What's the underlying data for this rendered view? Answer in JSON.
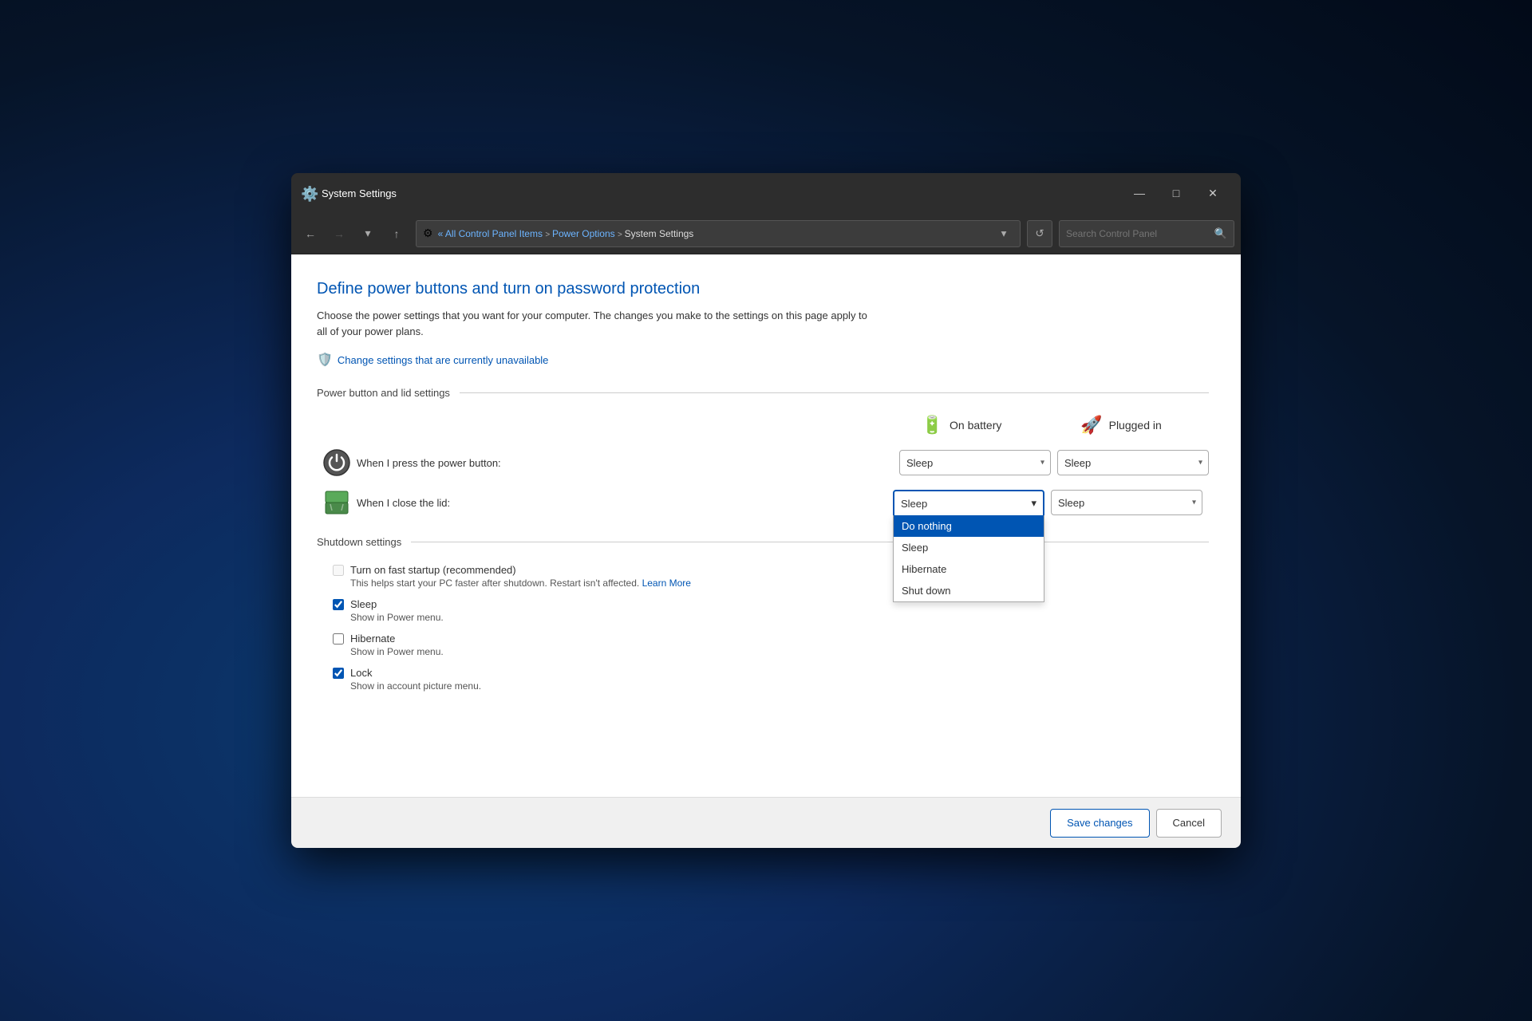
{
  "window": {
    "title": "System Settings",
    "icon": "⚙️"
  },
  "titlebar": {
    "minimize": "—",
    "maximize": "□",
    "close": "✕"
  },
  "navbar": {
    "back": "←",
    "forward": "→",
    "recent": "▾",
    "up": "↑",
    "address": {
      "icon": "⚙",
      "path": "« All Control Panel Items  >  Power Options  >  System Settings"
    },
    "search_placeholder": "Search Control Panel",
    "refresh": "↺"
  },
  "page": {
    "title": "Define power buttons and turn on password protection",
    "description": "Choose the power settings that you want for your computer. The changes you make to the settings on this page apply to all of your power plans.",
    "change_settings_link": "Change settings that are currently unavailable",
    "section_label": "Power button and lid settings",
    "columns": {
      "on_battery": "On battery",
      "plugged_in": "Plugged in"
    },
    "power_button_label": "When I press the power button:",
    "lid_label": "When I close the lid:",
    "power_button_value_battery": "Sleep",
    "power_button_value_plugged": "Sleep",
    "lid_value_battery": "Sleep",
    "lid_value_plugged": "Sleep",
    "dropdown_options": [
      "Do nothing",
      "Sleep",
      "Hibernate",
      "Shut down"
    ],
    "dropdown_selected": "Do nothing",
    "shutdown_section": "Shutdown settings",
    "checkboxes": [
      {
        "id": "fast_startup",
        "label": "Turn on fast startup (recommended)",
        "sublabel": "This helps start your PC faster after shutdown. Restart isn't affected.",
        "learn_more": "Learn More",
        "checked": false,
        "disabled": true
      },
      {
        "id": "sleep",
        "label": "Sleep",
        "sublabel": "Show in Power menu.",
        "checked": true,
        "disabled": false
      },
      {
        "id": "hibernate",
        "label": "Hibernate",
        "sublabel": "Show in Power menu.",
        "checked": false,
        "disabled": false
      },
      {
        "id": "lock",
        "label": "Lock",
        "sublabel": "Show in account picture menu.",
        "checked": true,
        "disabled": false
      }
    ]
  },
  "footer": {
    "save_label": "Save changes",
    "cancel_label": "Cancel"
  }
}
